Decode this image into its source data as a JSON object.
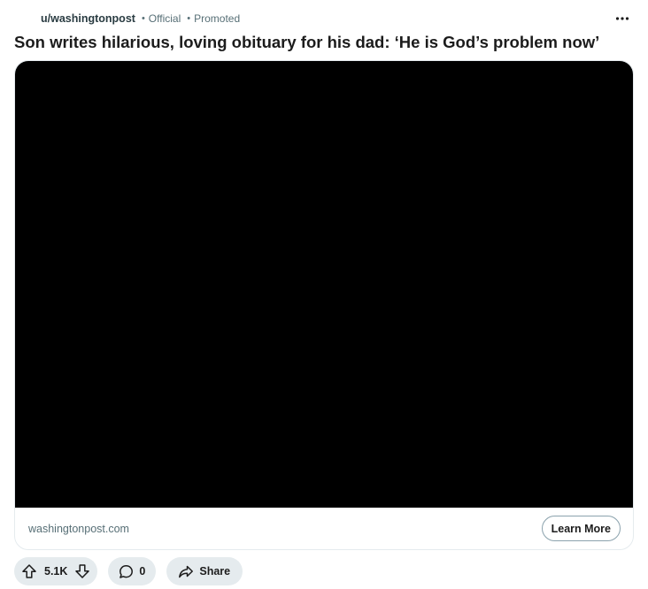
{
  "post": {
    "author": "u/washingtonpost",
    "separator": "•",
    "official_label": "Official",
    "promoted_label": "Promoted",
    "title": "Son writes hilarious, loving obituary for his dad: ‘He is God’s problem now’"
  },
  "link_card": {
    "domain": "washingtonpost.com",
    "cta_label": "Learn More"
  },
  "actions": {
    "score": "5.1K",
    "comment_count": "0",
    "share_label": "Share"
  },
  "icons": {
    "more": "more-horizontal-icon",
    "upvote": "upvote-arrow-icon",
    "downvote": "downvote-arrow-icon",
    "comment": "comment-bubble-icon",
    "share": "share-arrow-icon"
  },
  "colors": {
    "text_primary": "#1c1c1c",
    "text_secondary": "#576f76",
    "pill_background": "#e5ebee",
    "video_background": "#000000"
  }
}
